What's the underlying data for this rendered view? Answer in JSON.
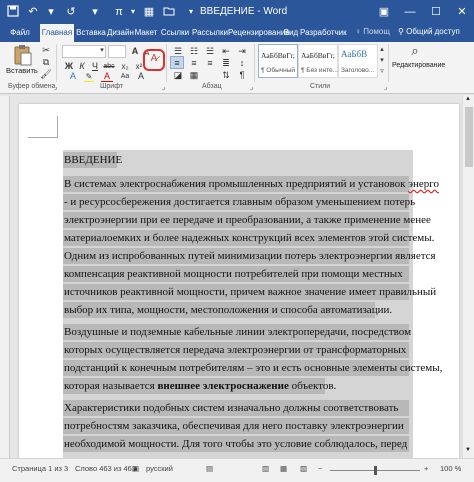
{
  "app": {
    "document_title": "ВВЕДЕНИЕ - Word"
  },
  "quick_access": {
    "save_icon": "save-icon",
    "undo_icon": "undo-icon",
    "redo_icon": "redo-icon",
    "pi_glyph": "π",
    "folder_icon": "folder-icon"
  },
  "window_controls": {
    "minimize": "—",
    "maximize": "☐",
    "close": "✕",
    "ribbon_options": "▣"
  },
  "tabs": [
    {
      "label": "Файл"
    },
    {
      "label": "Главная"
    },
    {
      "label": "Вставка"
    },
    {
      "label": "Дизайн"
    },
    {
      "label": "Макет"
    },
    {
      "label": "Ссылки"
    },
    {
      "label": "Рассылки"
    },
    {
      "label": "Рецензирование"
    },
    {
      "label": "Вид"
    },
    {
      "label": "Разработчик"
    }
  ],
  "tell_me": "Помощ",
  "share": "Общий доступ",
  "ribbon": {
    "paste_label": "Вставить",
    "font_size_buttons": [
      "A",
      "A"
    ],
    "case_button": "Aa",
    "bold": "Ж",
    "italic": "К",
    "underline": "Ч",
    "strike": "abc",
    "subscript": "x₂",
    "superscript": "x²",
    "font_color_letter": "A",
    "highlight_letter": "A",
    "styles": [
      {
        "sample": "АаБбВвГг,",
        "name": "¶ Обычный"
      },
      {
        "sample": "АаБбВвГг,",
        "name": "¶ Без инте..."
      },
      {
        "sample": "АаБбВ",
        "name": "Заголово..."
      }
    ],
    "editing_label": "Редактирование",
    "groups": {
      "clipboard": "Буфер обмена",
      "font": "Шрифт",
      "paragraph": "Абзац",
      "styles": "Стили"
    }
  },
  "document": {
    "lines": [
      "ВВЕДЕНИЕ",
      "В системах электроснабжения промышленных предприятий и установок энерго",
      "- и ресурсосбережения достигается главным образом уменьшением потерь",
      "электроэнергии при ее передаче и преобразовании, а также применение менее",
      "материалоемких и более надежных конструкций всех элементов этой системы.",
      "Одним из испробованных путей минимизации потерь электроэнергии является",
      "компенсация реактивной мощности потребителей при помощи местных",
      "источников реактивной мощности, причем важное значение имеет правильный",
      "выбор их типа, мощности, местоположения и способа автоматизации.",
      "Воздушные и подземные кабельные линии электропередачи, посредством",
      "которых осуществляется передача электроэнергии от трансформаторных",
      "подстанций к конечным потребителям – это и есть основные элементы системы,",
      "которая называется ",
      "внешнее электроснажение",
      " объектов.",
      "Характеристики подобных систем изначально должны соответствовать",
      "потребностям заказчика, обеспечивая для него поставку электроэнергии",
      "необходимой мощности. Для того чтобы это условие соблюдалось, перед"
    ]
  },
  "status": {
    "page": "Страница 1 из 3",
    "words": "Слово 463 из 463",
    "language": "русский",
    "zoom": "100 %"
  }
}
